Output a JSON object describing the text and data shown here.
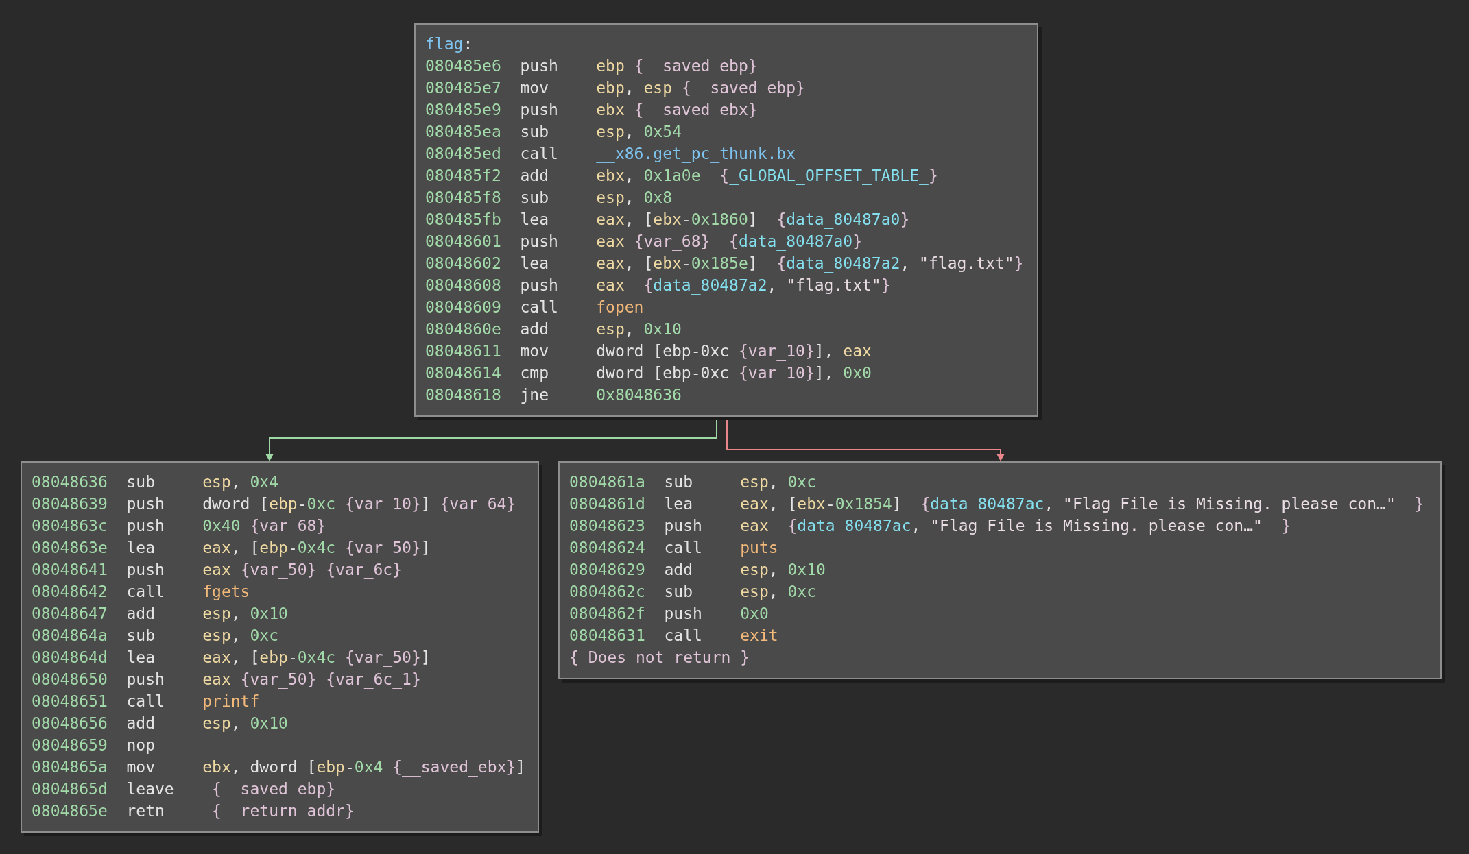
{
  "blocks": [
    {
      "label": [
        {
          "kind": "func",
          "text": "flag"
        },
        {
          "kind": "text",
          "text": ":"
        }
      ],
      "lines": [
        {
          "address": "080485e6",
          "mnemonic": "push",
          "operand": [
            {
              "kind": "reg",
              "text": "ebp"
            },
            {
              "kind": "var",
              "text": " {__saved_ebp}"
            }
          ]
        },
        {
          "address": "080485e7",
          "mnemonic": "mov",
          "operand": [
            {
              "kind": "reg",
              "text": "ebp"
            },
            {
              "kind": "text",
              "text": ", "
            },
            {
              "kind": "reg",
              "text": "esp"
            },
            {
              "kind": "var",
              "text": " {__saved_ebp}"
            }
          ]
        },
        {
          "address": "080485e9",
          "mnemonic": "push",
          "operand": [
            {
              "kind": "reg",
              "text": "ebx"
            },
            {
              "kind": "var",
              "text": " {__saved_ebx}"
            }
          ]
        },
        {
          "address": "080485ea",
          "mnemonic": "sub",
          "operand": [
            {
              "kind": "reg",
              "text": "esp"
            },
            {
              "kind": "text",
              "text": ", "
            },
            {
              "kind": "num",
              "text": "0x54"
            }
          ]
        },
        {
          "address": "080485ed",
          "mnemonic": "call",
          "operand": [
            {
              "kind": "func",
              "text": "__x86.get_pc_thunk.bx"
            }
          ]
        },
        {
          "address": "080485f2",
          "mnemonic": "add",
          "operand": [
            {
              "kind": "reg",
              "text": "ebx"
            },
            {
              "kind": "text",
              "text": ", "
            },
            {
              "kind": "num",
              "text": "0x1a0e"
            },
            {
              "kind": "var",
              "text": "  {"
            },
            {
              "kind": "data",
              "text": "_GLOBAL_OFFSET_TABLE_"
            },
            {
              "kind": "var",
              "text": "}"
            }
          ]
        },
        {
          "address": "080485f8",
          "mnemonic": "sub",
          "operand": [
            {
              "kind": "reg",
              "text": "esp"
            },
            {
              "kind": "text",
              "text": ", "
            },
            {
              "kind": "num",
              "text": "0x8"
            }
          ]
        },
        {
          "address": "080485fb",
          "mnemonic": "lea",
          "operand": [
            {
              "kind": "reg",
              "text": "eax"
            },
            {
              "kind": "text",
              "text": ", ["
            },
            {
              "kind": "reg",
              "text": "ebx"
            },
            {
              "kind": "text",
              "text": "-"
            },
            {
              "kind": "num",
              "text": "0x1860"
            },
            {
              "kind": "text",
              "text": "]"
            },
            {
              "kind": "var",
              "text": "  {"
            },
            {
              "kind": "data",
              "text": "data_80487a0"
            },
            {
              "kind": "var",
              "text": "}"
            }
          ]
        },
        {
          "address": "08048601",
          "mnemonic": "push",
          "operand": [
            {
              "kind": "reg",
              "text": "eax"
            },
            {
              "kind": "var",
              "text": " {var_68}  {"
            },
            {
              "kind": "data",
              "text": "data_80487a0"
            },
            {
              "kind": "var",
              "text": "}"
            }
          ]
        },
        {
          "address": "08048602",
          "mnemonic": "lea",
          "operand": [
            {
              "kind": "reg",
              "text": "eax"
            },
            {
              "kind": "text",
              "text": ", ["
            },
            {
              "kind": "reg",
              "text": "ebx"
            },
            {
              "kind": "text",
              "text": "-"
            },
            {
              "kind": "num",
              "text": "0x185e"
            },
            {
              "kind": "text",
              "text": "]"
            },
            {
              "kind": "var",
              "text": "  {"
            },
            {
              "kind": "data",
              "text": "data_80487a2"
            },
            {
              "kind": "text",
              "text": ", "
            },
            {
              "kind": "str",
              "text": "\"flag.txt\""
            },
            {
              "kind": "var",
              "text": "}"
            }
          ]
        },
        {
          "address": "08048608",
          "mnemonic": "push",
          "operand": [
            {
              "kind": "reg",
              "text": "eax"
            },
            {
              "kind": "var",
              "text": "  {"
            },
            {
              "kind": "data",
              "text": "data_80487a2"
            },
            {
              "kind": "text",
              "text": ", "
            },
            {
              "kind": "str",
              "text": "\"flag.txt\""
            },
            {
              "kind": "var",
              "text": "}"
            }
          ]
        },
        {
          "address": "08048609",
          "mnemonic": "call",
          "operand": [
            {
              "kind": "import",
              "text": "fopen"
            }
          ]
        },
        {
          "address": "0804860e",
          "mnemonic": "add",
          "operand": [
            {
              "kind": "reg",
              "text": "esp"
            },
            {
              "kind": "text",
              "text": ", "
            },
            {
              "kind": "num",
              "text": "0x10"
            }
          ]
        },
        {
          "address": "08048611",
          "mnemonic": "mov",
          "operand": [
            {
              "kind": "text",
              "text": "dword [ebp-0xc"
            },
            {
              "kind": "var",
              "text": " {var_10}"
            },
            {
              "kind": "text",
              "text": "], "
            },
            {
              "kind": "reg",
              "text": "eax"
            }
          ]
        },
        {
          "address": "08048614",
          "mnemonic": "cmp",
          "operand": [
            {
              "kind": "text",
              "text": "dword [ebp-0xc"
            },
            {
              "kind": "var",
              "text": " {var_10}"
            },
            {
              "kind": "text",
              "text": "], "
            },
            {
              "kind": "num",
              "text": "0x0"
            }
          ]
        },
        {
          "address": "08048618",
          "mnemonic": "jne",
          "operand": [
            {
              "kind": "num",
              "text": "0x8048636"
            }
          ]
        }
      ]
    },
    {
      "lines": [
        {
          "address": "08048636",
          "mnemonic": "sub",
          "operand": [
            {
              "kind": "reg",
              "text": "esp"
            },
            {
              "kind": "text",
              "text": ", "
            },
            {
              "kind": "num",
              "text": "0x4"
            }
          ]
        },
        {
          "address": "08048639",
          "mnemonic": "push",
          "operand": [
            {
              "kind": "text",
              "text": "dword ["
            },
            {
              "kind": "reg",
              "text": "ebp"
            },
            {
              "kind": "text",
              "text": "-"
            },
            {
              "kind": "num",
              "text": "0xc"
            },
            {
              "kind": "var",
              "text": " {var_10}"
            },
            {
              "kind": "text",
              "text": "]"
            },
            {
              "kind": "var",
              "text": " {var_64}"
            }
          ]
        },
        {
          "address": "0804863c",
          "mnemonic": "push",
          "operand": [
            {
              "kind": "num",
              "text": "0x40"
            },
            {
              "kind": "var",
              "text": " {var_68}"
            }
          ]
        },
        {
          "address": "0804863e",
          "mnemonic": "lea",
          "operand": [
            {
              "kind": "reg",
              "text": "eax"
            },
            {
              "kind": "text",
              "text": ", ["
            },
            {
              "kind": "reg",
              "text": "ebp"
            },
            {
              "kind": "text",
              "text": "-"
            },
            {
              "kind": "num",
              "text": "0x4c"
            },
            {
              "kind": "var",
              "text": " {var_50}"
            },
            {
              "kind": "text",
              "text": "]"
            }
          ]
        },
        {
          "address": "08048641",
          "mnemonic": "push",
          "operand": [
            {
              "kind": "reg",
              "text": "eax"
            },
            {
              "kind": "var",
              "text": " {var_50} {var_6c}"
            }
          ]
        },
        {
          "address": "08048642",
          "mnemonic": "call",
          "operand": [
            {
              "kind": "import",
              "text": "fgets"
            }
          ]
        },
        {
          "address": "08048647",
          "mnemonic": "add",
          "operand": [
            {
              "kind": "reg",
              "text": "esp"
            },
            {
              "kind": "text",
              "text": ", "
            },
            {
              "kind": "num",
              "text": "0x10"
            }
          ]
        },
        {
          "address": "0804864a",
          "mnemonic": "sub",
          "operand": [
            {
              "kind": "reg",
              "text": "esp"
            },
            {
              "kind": "text",
              "text": ", "
            },
            {
              "kind": "num",
              "text": "0xc"
            }
          ]
        },
        {
          "address": "0804864d",
          "mnemonic": "lea",
          "operand": [
            {
              "kind": "reg",
              "text": "eax"
            },
            {
              "kind": "text",
              "text": ", ["
            },
            {
              "kind": "reg",
              "text": "ebp"
            },
            {
              "kind": "text",
              "text": "-"
            },
            {
              "kind": "num",
              "text": "0x4c"
            },
            {
              "kind": "var",
              "text": " {var_50}"
            },
            {
              "kind": "text",
              "text": "]"
            }
          ]
        },
        {
          "address": "08048650",
          "mnemonic": "push",
          "operand": [
            {
              "kind": "reg",
              "text": "eax"
            },
            {
              "kind": "var",
              "text": " {var_50} {var_6c_1}"
            }
          ]
        },
        {
          "address": "08048651",
          "mnemonic": "call",
          "operand": [
            {
              "kind": "import",
              "text": "printf"
            }
          ]
        },
        {
          "address": "08048656",
          "mnemonic": "add",
          "operand": [
            {
              "kind": "reg",
              "text": "esp"
            },
            {
              "kind": "text",
              "text": ", "
            },
            {
              "kind": "num",
              "text": "0x10"
            }
          ]
        },
        {
          "address": "08048659",
          "mnemonic": "nop"
        },
        {
          "address": "0804865a",
          "mnemonic": "mov",
          "operand": [
            {
              "kind": "reg",
              "text": "ebx"
            },
            {
              "kind": "text",
              "text": ", dword ["
            },
            {
              "kind": "reg",
              "text": "ebp"
            },
            {
              "kind": "text",
              "text": "-"
            },
            {
              "kind": "num",
              "text": "0x4"
            },
            {
              "kind": "var",
              "text": " {__saved_ebx}"
            },
            {
              "kind": "text",
              "text": "]"
            }
          ]
        },
        {
          "address": "0804865d",
          "mnemonic": "leave",
          "operand": [
            {
              "kind": "var",
              "text": " {__saved_ebp}"
            }
          ]
        },
        {
          "address": "0804865e",
          "mnemonic": "retn",
          "operand": [
            {
              "kind": "var",
              "text": " {__return_addr}"
            }
          ]
        }
      ]
    },
    {
      "lines": [
        {
          "address": "0804861a",
          "mnemonic": "sub",
          "operand": [
            {
              "kind": "reg",
              "text": "esp"
            },
            {
              "kind": "text",
              "text": ", "
            },
            {
              "kind": "num",
              "text": "0xc"
            }
          ]
        },
        {
          "address": "0804861d",
          "mnemonic": "lea",
          "operand": [
            {
              "kind": "reg",
              "text": "eax"
            },
            {
              "kind": "text",
              "text": ", ["
            },
            {
              "kind": "reg",
              "text": "ebx"
            },
            {
              "kind": "text",
              "text": "-"
            },
            {
              "kind": "num",
              "text": "0x1854"
            },
            {
              "kind": "text",
              "text": "]"
            },
            {
              "kind": "var",
              "text": "  {"
            },
            {
              "kind": "data",
              "text": "data_80487ac"
            },
            {
              "kind": "text",
              "text": ", "
            },
            {
              "kind": "str",
              "text": "\"Flag File is Missing. please con…\""
            },
            {
              "kind": "var",
              "text": "  }"
            }
          ]
        },
        {
          "address": "08048623",
          "mnemonic": "push",
          "operand": [
            {
              "kind": "reg",
              "text": "eax"
            },
            {
              "kind": "var",
              "text": "  {"
            },
            {
              "kind": "data",
              "text": "data_80487ac"
            },
            {
              "kind": "text",
              "text": ", "
            },
            {
              "kind": "str",
              "text": "\"Flag File is Missing. please con…\""
            },
            {
              "kind": "var",
              "text": "  }"
            }
          ]
        },
        {
          "address": "08048624",
          "mnemonic": "call",
          "operand": [
            {
              "kind": "import",
              "text": "puts"
            }
          ]
        },
        {
          "address": "08048629",
          "mnemonic": "add",
          "operand": [
            {
              "kind": "reg",
              "text": "esp"
            },
            {
              "kind": "text",
              "text": ", "
            },
            {
              "kind": "num",
              "text": "0x10"
            }
          ]
        },
        {
          "address": "0804862c",
          "mnemonic": "sub",
          "operand": [
            {
              "kind": "reg",
              "text": "esp"
            },
            {
              "kind": "text",
              "text": ", "
            },
            {
              "kind": "num",
              "text": "0xc"
            }
          ]
        },
        {
          "address": "0804862f",
          "mnemonic": "push",
          "operand": [
            {
              "kind": "num",
              "text": "0x0"
            }
          ]
        },
        {
          "address": "08048631",
          "mnemonic": "call",
          "operand": [
            {
              "kind": "import",
              "text": "exit"
            }
          ]
        }
      ],
      "note": "{ Does not return }"
    }
  ],
  "edges": [
    {
      "color": "#9fd8a4"
    },
    {
      "color": "#e8868c"
    }
  ]
}
